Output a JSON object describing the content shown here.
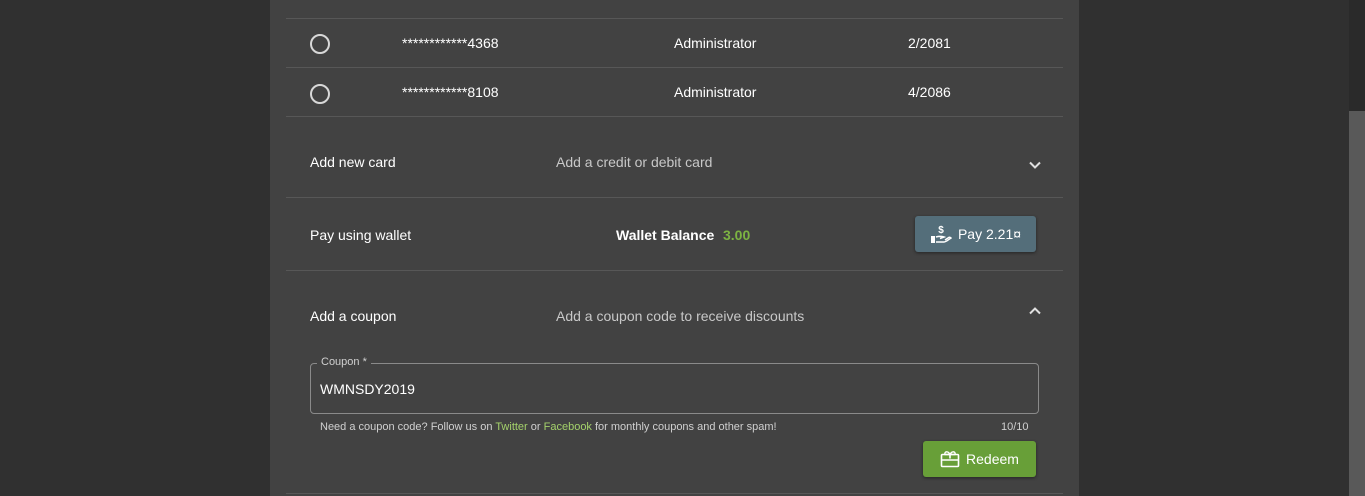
{
  "cards": [
    {
      "number": "************4368",
      "role": "Administrator",
      "expiry": "2/2081"
    },
    {
      "number": "************8108",
      "role": "Administrator",
      "expiry": "4/2086"
    }
  ],
  "add_card": {
    "title": "Add new card",
    "subtitle": "Add a credit or debit card",
    "icon": "chevron-down-icon"
  },
  "wallet": {
    "title": "Pay using wallet",
    "balance_label": "Wallet Balance",
    "balance_value": "3.00",
    "pay_button": "Pay 2.21¤",
    "pay_icon": "hand-money-icon"
  },
  "coupon": {
    "title": "Add a coupon",
    "subtitle": "Add a coupon code to receive discounts",
    "icon": "chevron-up-icon",
    "field_label": "Coupon *",
    "field_value": "WMNSDY2019",
    "hint_prefix": "Need a coupon code? Follow us on",
    "hint_twitter": "Twitter",
    "hint_or": "or",
    "hint_facebook": "Facebook",
    "hint_suffix": "for monthly coupons and other spam!",
    "counter": "10/10",
    "redeem_button": "Redeem",
    "redeem_icon": "gift-card-icon"
  },
  "colors": {
    "page_bg": "#303030",
    "panel_bg": "#424242",
    "accent_green": "#7cb342",
    "pay_button_bg": "#546e7a",
    "redeem_button_bg": "#689f38",
    "link_green": "#a4d16b"
  }
}
